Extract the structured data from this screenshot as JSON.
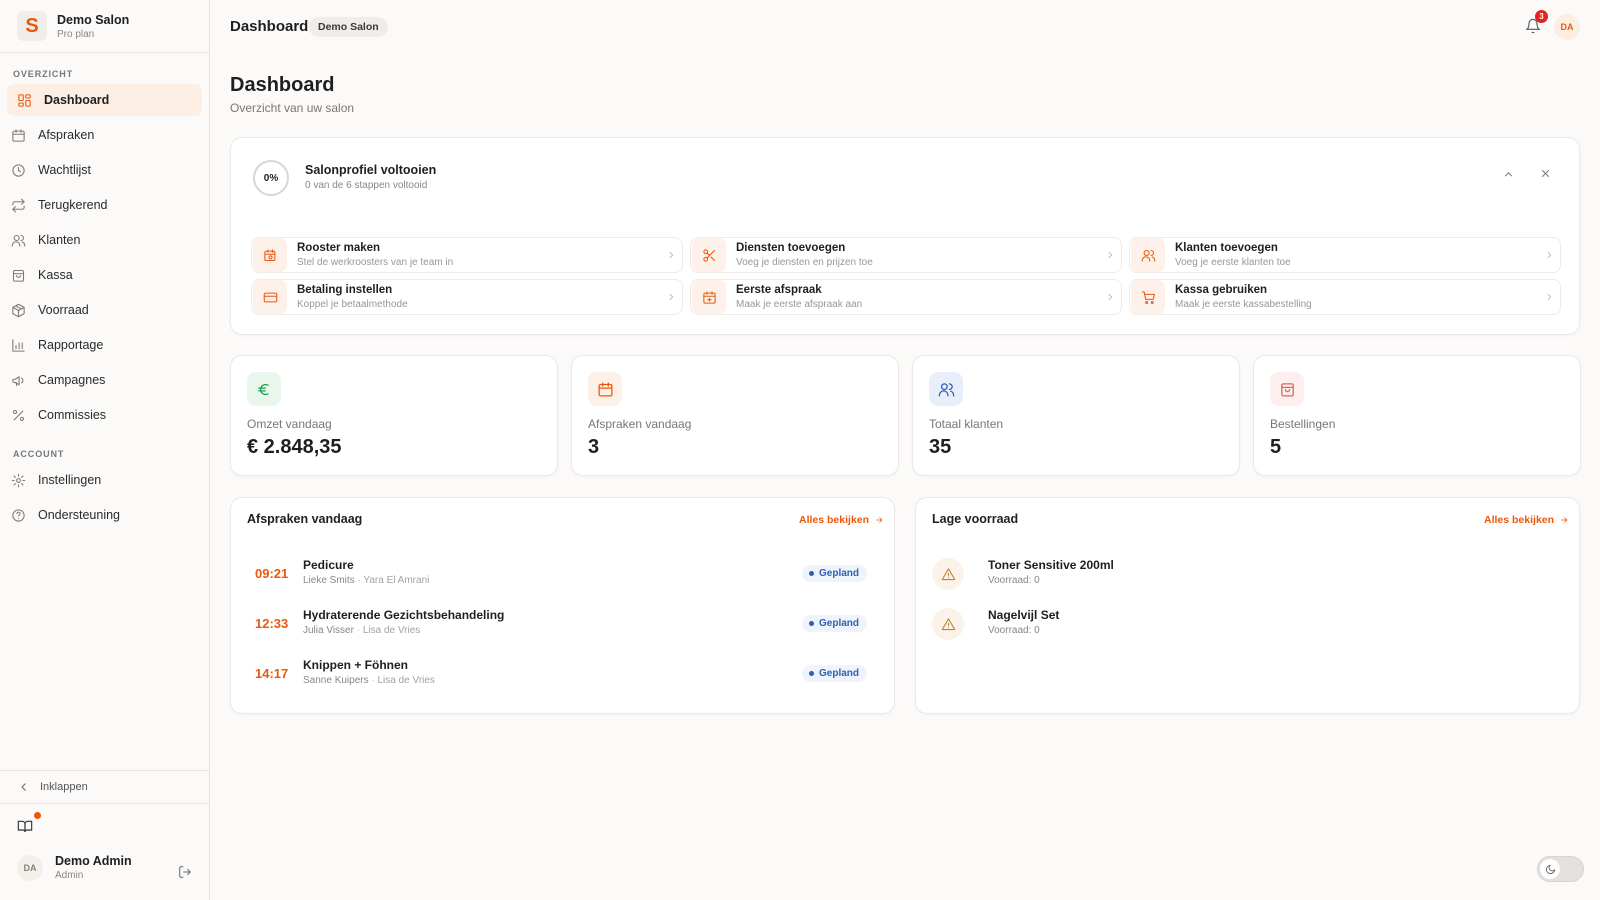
{
  "brand": {
    "logo": "S",
    "name": "Demo Salon",
    "plan": "Pro plan"
  },
  "sidebar": {
    "section_overview": "OVERZICHT",
    "section_account": "ACCOUNT",
    "items": [
      {
        "label": "Dashboard",
        "icon": "grid-icon"
      },
      {
        "label": "Afspraken",
        "icon": "calendar-icon"
      },
      {
        "label": "Wachtlijst",
        "icon": "clock-icon"
      },
      {
        "label": "Terugkerend",
        "icon": "repeat-icon"
      },
      {
        "label": "Klanten",
        "icon": "users-icon"
      },
      {
        "label": "Kassa",
        "icon": "shopping-bag-icon"
      },
      {
        "label": "Voorraad",
        "icon": "package-icon"
      },
      {
        "label": "Rapportage",
        "icon": "bar-chart-icon"
      },
      {
        "label": "Campagnes",
        "icon": "megaphone-icon"
      },
      {
        "label": "Commissies",
        "icon": "percent-icon"
      }
    ],
    "account_items": [
      {
        "label": "Instellingen",
        "icon": "gear-icon"
      },
      {
        "label": "Ondersteuning",
        "icon": "help-circle-icon"
      }
    ],
    "collapse_label": "Inklappen",
    "user": {
      "initials": "DA",
      "name": "Demo Admin",
      "role": "Admin"
    }
  },
  "header": {
    "title": "Dashboard",
    "salon_badge": "Demo Salon",
    "notification_count": "3",
    "avatar_initials": "DA"
  },
  "page": {
    "title": "Dashboard",
    "subtitle": "Overzicht van uw salon"
  },
  "setup": {
    "progress": "0%",
    "title": "Salonprofiel voltooien",
    "subtitle": "0 van de 6 stappen voltooid",
    "steps": [
      {
        "title": "Rooster maken",
        "subtitle": "Stel de werkroosters van je team in",
        "icon": "calendar-clock-icon"
      },
      {
        "title": "Diensten toevoegen",
        "subtitle": "Voeg je diensten en prijzen toe",
        "icon": "scissors-icon"
      },
      {
        "title": "Klanten toevoegen",
        "subtitle": "Voeg je eerste klanten toe",
        "icon": "users-icon"
      },
      {
        "title": "Betaling instellen",
        "subtitle": "Koppel je betaalmethode",
        "icon": "credit-card-icon"
      },
      {
        "title": "Eerste afspraak",
        "subtitle": "Maak je eerste afspraak aan",
        "icon": "calendar-plus-icon"
      },
      {
        "title": "Kassa gebruiken",
        "subtitle": "Maak je eerste kassabestelling",
        "icon": "cart-icon"
      }
    ]
  },
  "stats": [
    {
      "label": "Omzet vandaag",
      "value": "€ 2.848,35",
      "icon": "euro-icon",
      "color": "#16a34a",
      "bg": "#e8f6ec"
    },
    {
      "label": "Afspraken vandaag",
      "value": "3",
      "icon": "calendar-icon",
      "color": "#ea580c",
      "bg": "#fdf0e7"
    },
    {
      "label": "Totaal klanten",
      "value": "35",
      "icon": "users-icon",
      "color": "#2f5fb3",
      "bg": "#e9effa"
    },
    {
      "label": "Bestellingen",
      "value": "5",
      "icon": "shopping-bag-icon",
      "color": "#d9695a",
      "bg": "#fcefee"
    }
  ],
  "appointments": {
    "title": "Afspraken vandaag",
    "link": "Alles bekijken",
    "items": [
      {
        "time": "09:21",
        "service": "Pedicure",
        "client": "Lieke Smits",
        "staff": "Yara El Amrani",
        "status": "Gepland"
      },
      {
        "time": "12:33",
        "service": "Hydraterende Gezichtsbehandeling",
        "client": "Julia Visser",
        "staff": "Lisa de Vries",
        "status": "Gepland"
      },
      {
        "time": "14:17",
        "service": "Knippen + Föhnen",
        "client": "Sanne Kuipers",
        "staff": "Lisa de Vries",
        "status": "Gepland"
      }
    ]
  },
  "low_stock": {
    "title": "Lage voorraad",
    "link": "Alles bekijken",
    "items": [
      {
        "name": "Toner Sensitive 200ml",
        "stock": "Voorraad: 0"
      },
      {
        "name": "Nagelvijl Set",
        "stock": "Voorraad: 0"
      }
    ]
  },
  "colors": {
    "accent": "#ea580c",
    "status_blue": "#2f5fb3",
    "warning": "#c2862a"
  }
}
